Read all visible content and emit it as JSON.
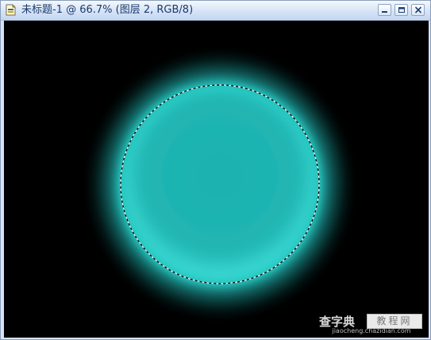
{
  "window": {
    "title": "未标题-1 @ 66.7% (图层 2, RGB/8)"
  },
  "controls": {
    "minimize": "minimize-icon",
    "maximize": "maximize-icon",
    "close": "close-icon"
  },
  "canvas": {
    "background": "#000000",
    "circle_fill": "#1fb5b2",
    "glow_color": "#2ee6e0",
    "selection": "marching-ants"
  },
  "watermark": {
    "brand": "查字典",
    "tag": "教程网",
    "url": "jiaocheng.chazidian.com"
  }
}
